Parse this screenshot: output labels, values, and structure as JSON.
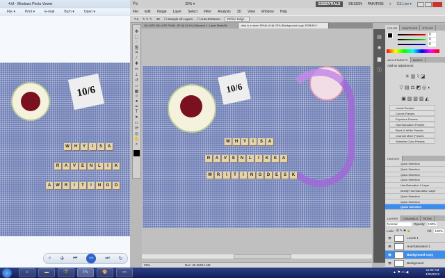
{
  "photo_viewer": {
    "title": "4.tif - Windows Photo Viewer",
    "menu": [
      "File ▾",
      "Print ▾",
      "E-mail",
      "Burn ▾",
      "Open ▾"
    ],
    "card_text": "10/6",
    "tile_rows": [
      [
        "W",
        "H",
        "Y",
        "I",
        "S",
        "A"
      ],
      [
        "R",
        "A",
        "V",
        "E",
        "N",
        "L",
        "I",
        "K"
      ],
      [
        "A",
        "W",
        "R",
        "I",
        "T",
        "I",
        "N",
        "G",
        "D"
      ]
    ],
    "controls": [
      "search-icon",
      "fit-icon",
      "previous-icon",
      "slideshow-icon",
      "next-icon",
      "rotate-icon"
    ]
  },
  "photoshop": {
    "logo": "Ps",
    "zoom_select": "25% ▾",
    "workspaces": [
      "ESSENTIALS",
      "DESIGN",
      "PAINTING",
      "»"
    ],
    "cs_live": "CS Live ▾",
    "menu": [
      "File",
      "Edit",
      "Image",
      "Layer",
      "Select",
      "Filter",
      "Analysis",
      "3D",
      "View",
      "Window",
      "Help"
    ],
    "options": {
      "brush_size": "30",
      "sample_all_layers": "Sample All Layers",
      "auto_enhance": "Auto-Enhance",
      "refine_edge": "Refine Edge..."
    },
    "doc_tabs": [
      {
        "label": "JM LATE JM LATE FINAL.JIF @ 41.6% (Vibrance 1, Layer Mask/8)",
        "active": false
      },
      {
        "label": "why is a raven FINAL.tif @ 25% (Background copy, RGB/8*) *",
        "active": true
      }
    ],
    "canvas": {
      "card_text": "10/6",
      "tile_rows": [
        [
          "W",
          "H",
          "Y",
          "I",
          "S",
          "A"
        ],
        [
          "R",
          "A",
          "V",
          "E",
          "N",
          "L",
          "I",
          "K",
          "E",
          "A"
        ],
        [
          "W",
          "R",
          "I",
          "T",
          "I",
          "N",
          "G",
          "D",
          "E",
          "S",
          "K"
        ]
      ]
    },
    "status": {
      "zoom": "25%",
      "doc": "Doc: 25.3M/11.6M"
    },
    "color_panel": {
      "tabs": [
        "COLOR",
        "SWATCHES",
        "STYLES"
      ],
      "r": "0",
      "g": "0",
      "b": "0"
    },
    "adjustments_panel": {
      "tabs": [
        "ADJUSTMENTS",
        "MASKS"
      ],
      "heading": "Add an adjustment",
      "presets": [
        "Levels Presets",
        "Curves Presets",
        "Exposure Presets",
        "Hue/Saturation Presets",
        "Black & White Presets",
        "Channel Mixer Presets",
        "Selective Color Presets"
      ]
    },
    "history_panel": {
      "tabs": [
        "HISTORY"
      ],
      "items": [
        "Quick Selection",
        "Quick Selection",
        "Quick Selection",
        "Quick Selection",
        "Hue/Saturation 1 Layer",
        "Modify Hue/Saturation Layer",
        "Quick Selection",
        "Quick Selection",
        "Quick Selection"
      ],
      "selected": 8
    },
    "layers_panel": {
      "tabs": [
        "LAYERS",
        "CHANNELS",
        "PATHS"
      ],
      "blend_mode": "Normal",
      "opacity_label": "Opacity:",
      "opacity": "100%",
      "lock_label": "Lock:",
      "fill_label": "Fill:",
      "fill": "100%",
      "layers": [
        {
          "name": "Levels 1",
          "selected": false
        },
        {
          "name": "Hue/Saturation 1",
          "selected": false
        },
        {
          "name": "Background copy",
          "selected": true
        },
        {
          "name": "Background",
          "selected": false
        }
      ]
    }
  },
  "taskbar": {
    "apps": [
      "start-icon",
      "ie-icon",
      "explorer-icon",
      "media-icon",
      "photoshop-icon",
      "paint-icon",
      "photo-viewer-icon"
    ],
    "ps_label": "Ps",
    "time": "11:02 AM",
    "date": "4/06/2013"
  },
  "colors": {
    "selection": "#3b8ef0",
    "taskbar": "#1b2a6b",
    "gingham": "#6f7fb6"
  }
}
